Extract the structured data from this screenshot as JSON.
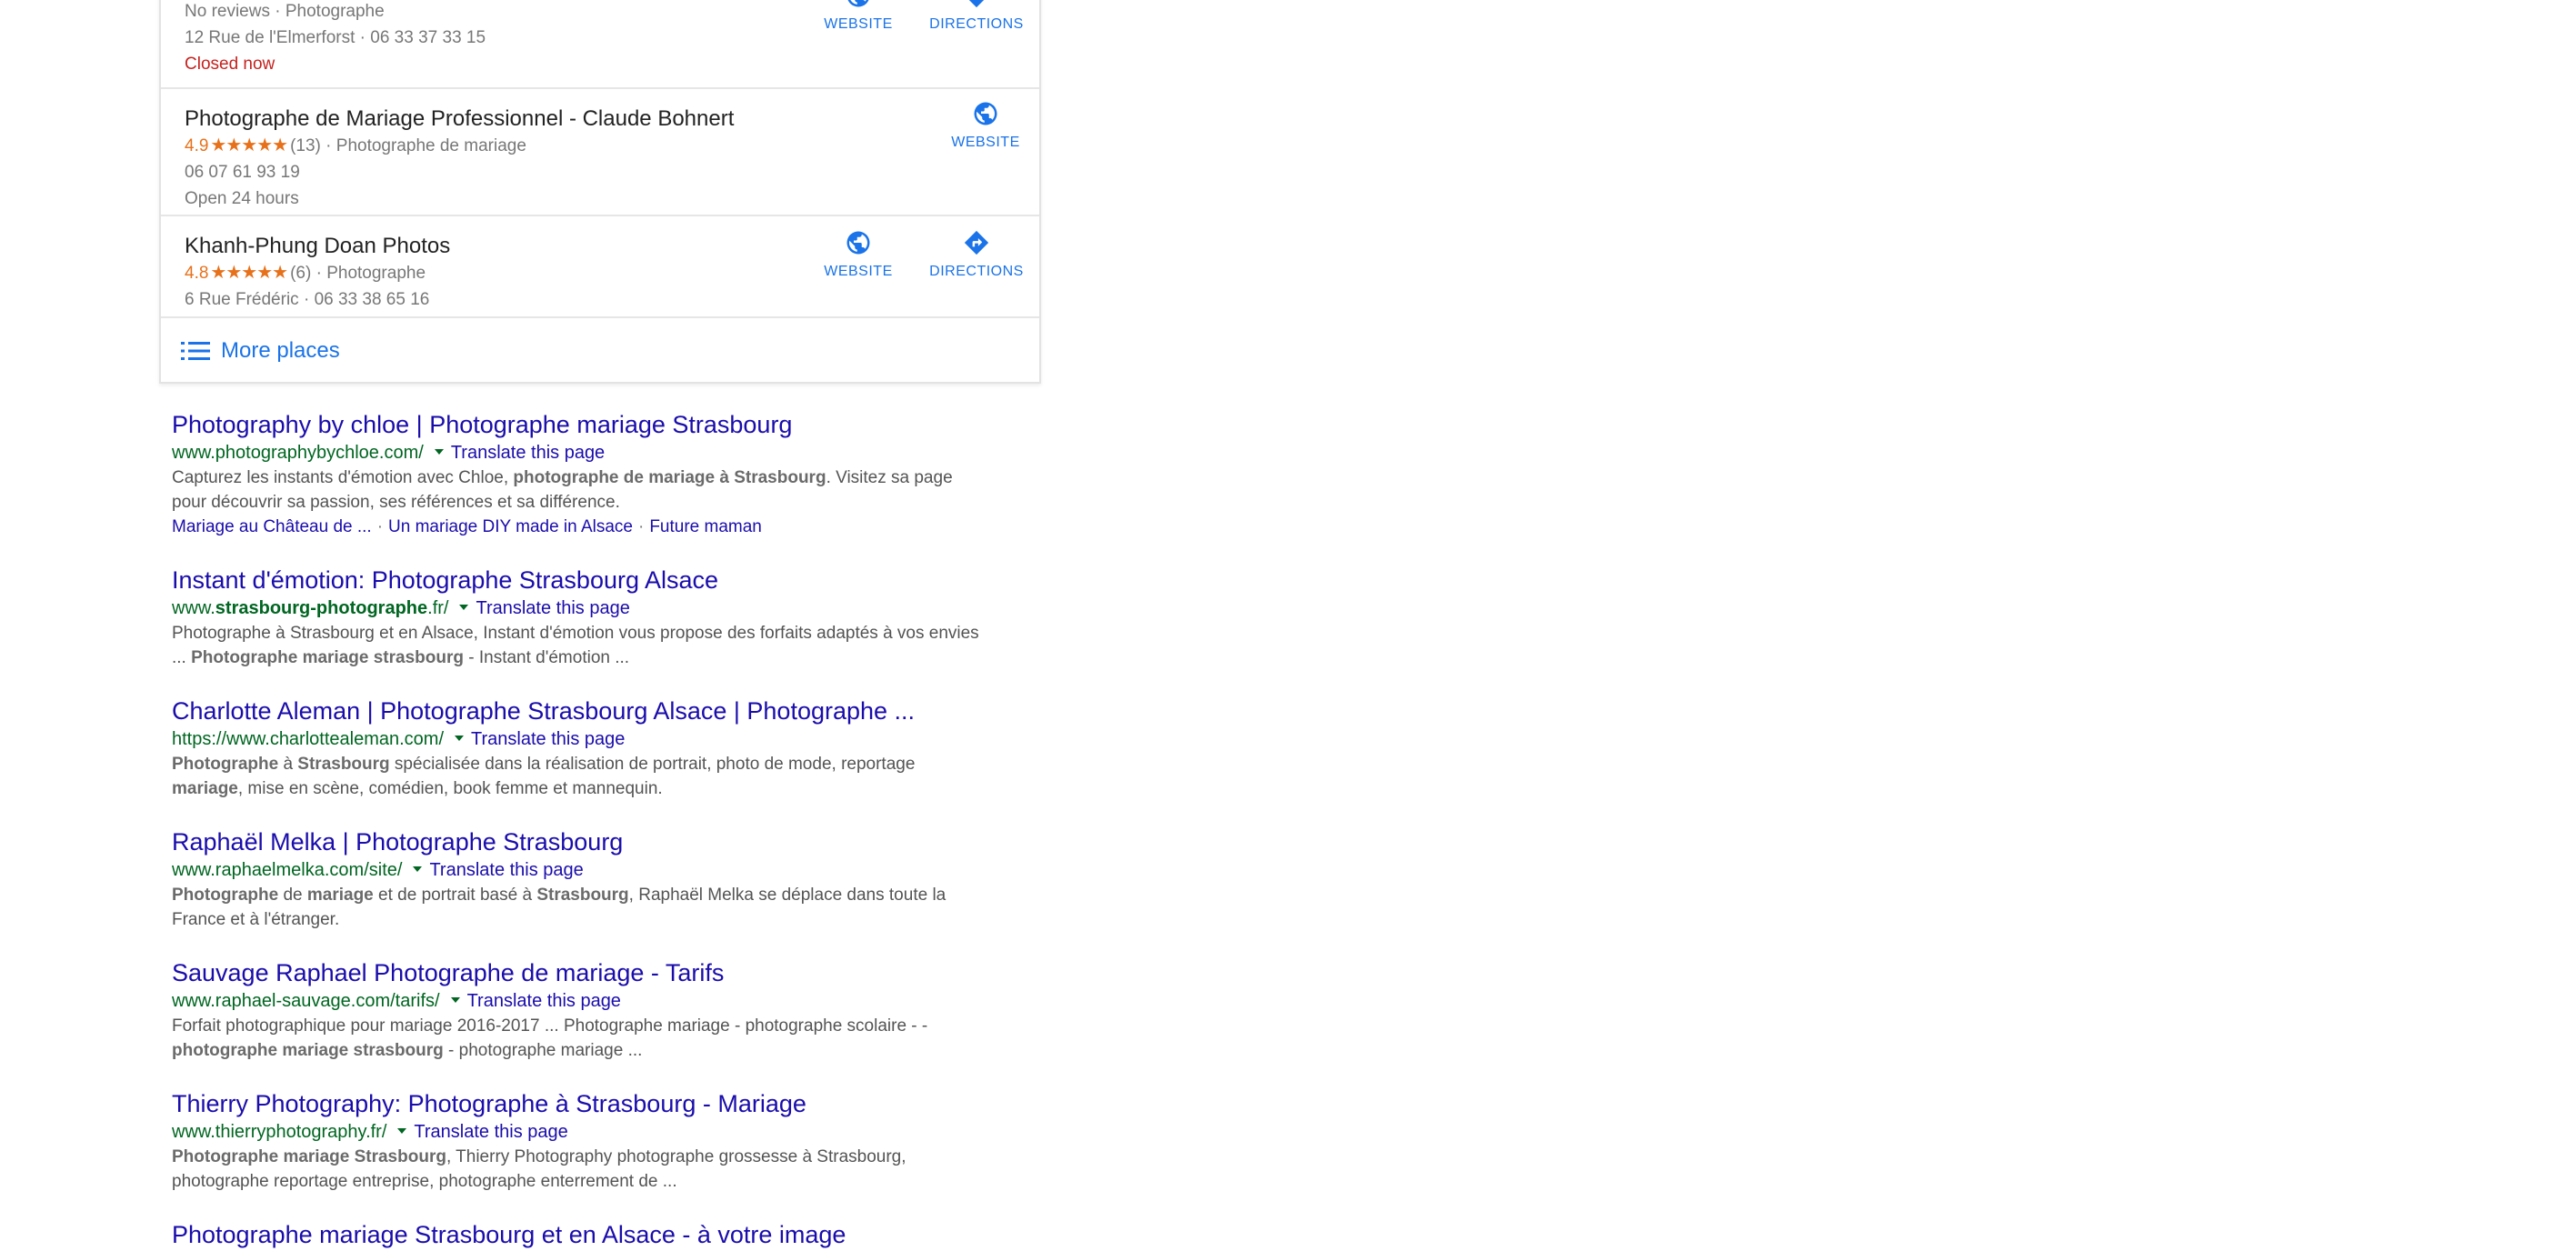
{
  "local_pack": {
    "places": [
      {
        "name": "",
        "reviews": "No reviews",
        "category": "Photographe",
        "address": "12 Rue de l'Elmerforst",
        "phone": "06 33 37 33 15",
        "status": "Closed now",
        "actions": {
          "website": "WEBSITE",
          "directions": "DIRECTIONS"
        }
      },
      {
        "name": "Photographe de Mariage Professionnel - Claude Bohnert",
        "rating": "4.9",
        "stars": "★★★★★",
        "review_count": "(13)",
        "category": "Photographe de mariage",
        "phone": "06 07 61 93 19",
        "status": "Open 24 hours",
        "actions": {
          "website": "WEBSITE"
        }
      },
      {
        "name": "Khanh-Phung Doan Photos",
        "rating": "4.8",
        "stars": "★★★★★",
        "review_count": "(6)",
        "category": "Photographe",
        "address": "6 Rue Frédéric",
        "phone": "06 33 38 65 16",
        "actions": {
          "website": "WEBSITE",
          "directions": "DIRECTIONS"
        }
      }
    ],
    "more_places": "More places",
    "separator": "·"
  },
  "results": [
    {
      "title": "Photography by chloe | Photographe mariage Strasbourg",
      "url": "www.photographybychloe.com/",
      "translate": "Translate this page",
      "snippet": {
        "p1": "Capturez les instants d'émotion avec Chloe, ",
        "b1": "photographe de mariage à Strasbourg",
        "p2": ". Visitez sa page pour découvrir sa passion, ses références et sa différence."
      },
      "sitelinks": [
        "Mariage au Château de ...",
        "Un mariage DIY made in Alsace",
        "Future maman"
      ]
    },
    {
      "title": "Instant d'émotion: Photographe Strasbourg Alsace",
      "url_prefix": "www.",
      "url_bold": "strasbourg-photographe",
      "url_suffix": ".fr/",
      "translate": "Translate this page",
      "snippet": {
        "p1": "Photographe à Strasbourg et en Alsace, Instant d'émotion vous propose des forfaits adaptés à vos envies ... ",
        "b1": "Photographe mariage strasbourg",
        "p2": " - Instant d'émotion ..."
      }
    },
    {
      "title": "Charlotte Aleman | Photographe Strasbourg Alsace | Photographe ...",
      "url": "https://www.charlottealeman.com/",
      "translate": "Translate this page",
      "snippet": {
        "b1": "Photographe",
        "p1": " à ",
        "b2": "Strasbourg",
        "p2": " spécialisée dans la réalisation de portrait, photo de mode, reportage ",
        "b3": "mariage",
        "p3": ", mise en scène, comédien, book femme et mannequin."
      }
    },
    {
      "title": "Raphaël Melka | Photographe Strasbourg",
      "url": "www.raphaelmelka.com/site/",
      "translate": "Translate this page",
      "snippet": {
        "b1": "Photographe",
        "p1": " de ",
        "b2": "mariage",
        "p2": " et de portrait basé à ",
        "b3": "Strasbourg",
        "p3": ", Raphaël Melka se déplace dans toute la France et à l'étranger."
      }
    },
    {
      "title": "Sauvage Raphael Photographe de mariage - Tarifs",
      "url": "www.raphael-sauvage.com/tarifs/",
      "translate": "Translate this page",
      "snippet": {
        "p1": "Forfait photographique pour mariage 2016-2017 ... Photographe mariage - photographe scolaire - - ",
        "b1": "photographe mariage strasbourg",
        "p2": " - photographe mariage ..."
      }
    },
    {
      "title": "Thierry Photography: Photographe à Strasbourg - Mariage",
      "url": "www.thierryphotography.fr/",
      "translate": "Translate this page",
      "snippet": {
        "b1": "Photographe mariage Strasbourg",
        "p1": ", Thierry Photography photographe grossesse à Strasbourg, photographe reportage entreprise, photographe enterrement de ..."
      }
    },
    {
      "title": "Photographe mariage Strasbourg et en Alsace - à votre image"
    }
  ],
  "colors": {
    "link": "#1a0dab",
    "url": "#006621",
    "action_blue": "#1a73e8",
    "rating_orange": "#e7711b",
    "closed_red": "#c5221f"
  },
  "icons": {
    "website": "globe-icon",
    "directions": "directions-arrow-icon",
    "more_places": "list-icon",
    "translate_menu": "caret-down-icon"
  }
}
